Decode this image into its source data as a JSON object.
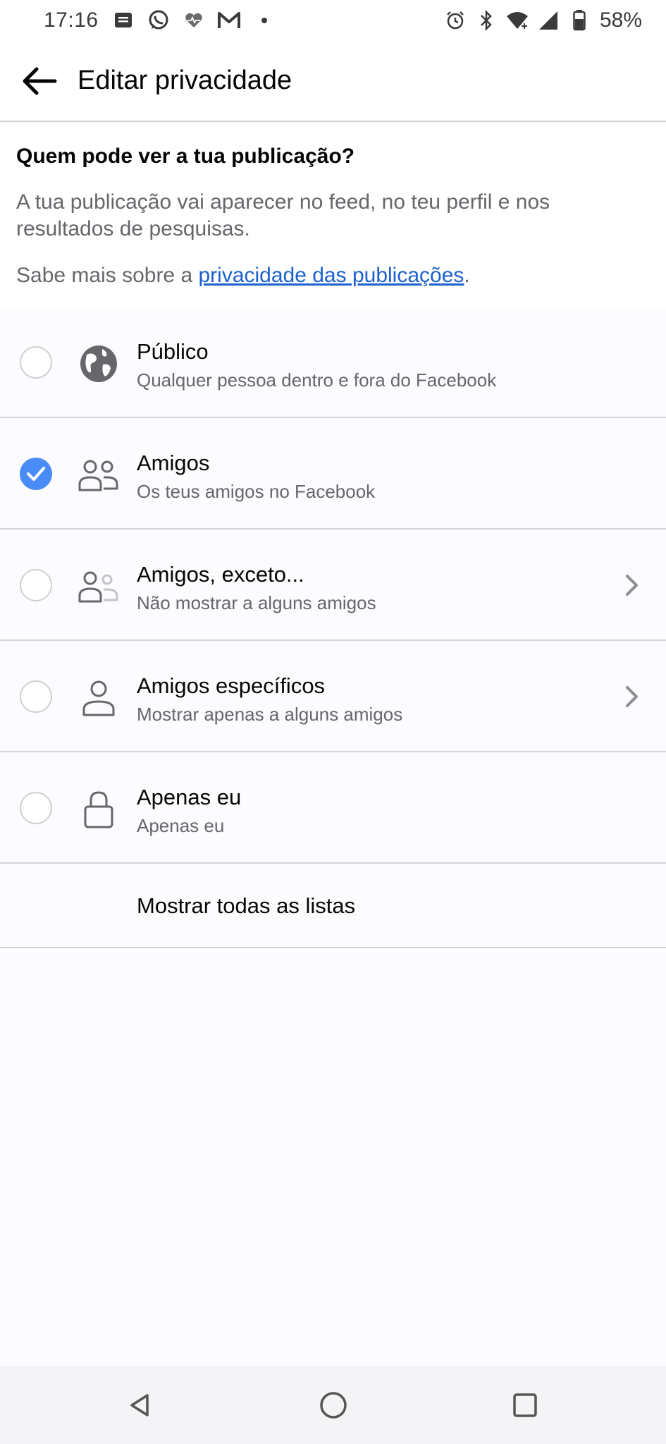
{
  "status_bar": {
    "time": "17:16",
    "battery": "58%",
    "left_icons": [
      "messages-icon",
      "whatsapp-icon",
      "heart-icon",
      "gmail-icon",
      "dot-icon"
    ],
    "right_icons": [
      "alarm-icon",
      "bluetooth-icon",
      "wifi-icon",
      "signal-icon",
      "battery-icon"
    ]
  },
  "header": {
    "title": "Editar privacidade",
    "back_icon": "back-arrow-icon"
  },
  "intro": {
    "question": "Quem pode ver a tua publicação?",
    "description": "A tua publicação vai aparecer no feed, no teu perfil e nos resultados de pesquisas.",
    "learn_prefix": "Sabe mais sobre a ",
    "learn_link": "privacidade das publicações",
    "learn_suffix": "."
  },
  "options": [
    {
      "title": "Público",
      "subtitle": "Qualquer pessoa dentro e fora do Facebook",
      "icon": "globe-icon",
      "selected": false,
      "has_chevron": false
    },
    {
      "title": "Amigos",
      "subtitle": "Os teus amigos no Facebook",
      "icon": "friends-icon",
      "selected": true,
      "has_chevron": false
    },
    {
      "title": "Amigos, exceto...",
      "subtitle": "Não mostrar a alguns amigos",
      "icon": "friends-except-icon",
      "selected": false,
      "has_chevron": true
    },
    {
      "title": "Amigos específicos",
      "subtitle": "Mostrar apenas a alguns amigos",
      "icon": "person-icon",
      "selected": false,
      "has_chevron": true
    },
    {
      "title": "Apenas eu",
      "subtitle": "Apenas eu",
      "icon": "lock-icon",
      "selected": false,
      "has_chevron": false
    }
  ],
  "show_all_lists": "Mostrar todas as listas",
  "nav_bar": {
    "icons": [
      "back-triangle-icon",
      "home-circle-icon",
      "recents-square-icon"
    ]
  },
  "colors": {
    "accent": "#4a8cf7",
    "link": "#1b61d0",
    "secondary_text": "#65676b",
    "divider": "#d4d4d8"
  }
}
